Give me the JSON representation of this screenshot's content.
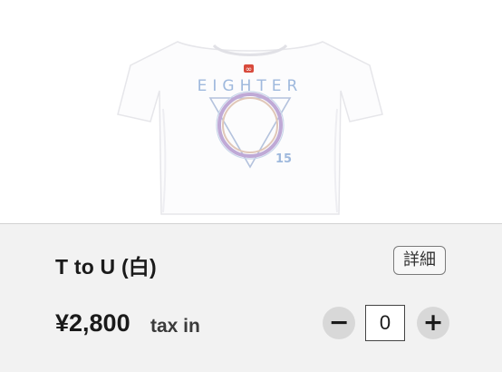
{
  "product": {
    "shirt_text": "EIGHTER",
    "shirt_number": "15",
    "logo_mark": "∞",
    "name": "T to U (白)",
    "detail_label": "詳細",
    "price": "¥2,800",
    "tax_label": "tax in",
    "quantity": "0",
    "minus_label": "−",
    "plus_label": "+"
  },
  "colors": {
    "card_bg": "#f2f2f2",
    "stepper_bg": "#d8d8d8",
    "shirt_print_blue": "#9fb9dd",
    "ring_lavender": "#bfa9d6"
  }
}
